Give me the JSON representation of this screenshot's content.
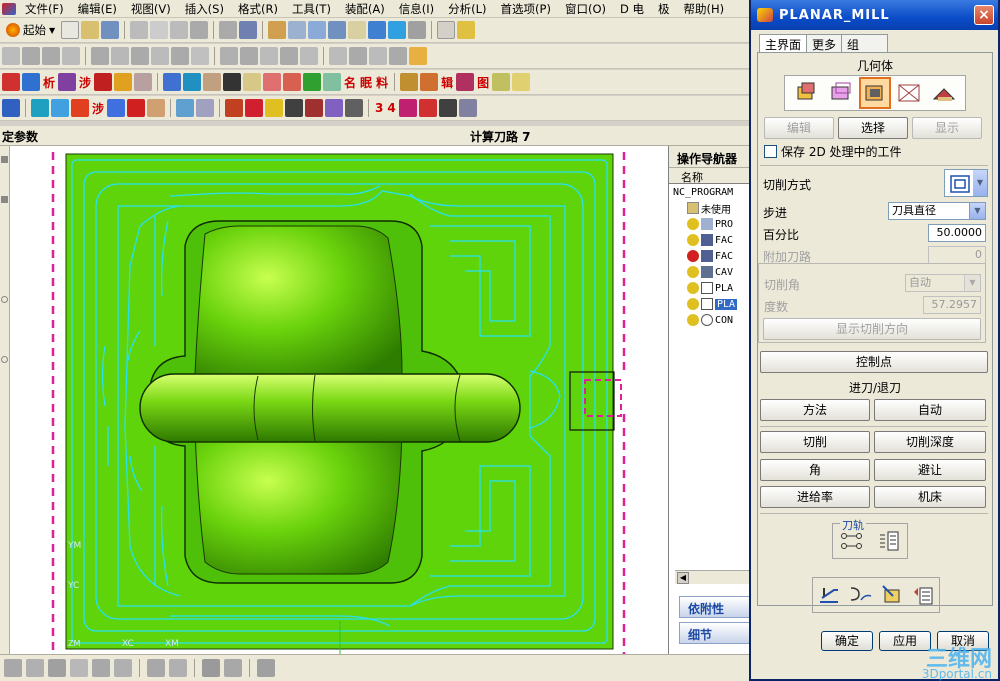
{
  "menubar": {
    "items": [
      "文件(F)",
      "编辑(E)",
      "视图(V)",
      "插入(S)",
      "格式(R)",
      "工具(T)",
      "装配(A)",
      "信息(I)",
      "分析(L)",
      "首选项(P)",
      "窗口(O)",
      "D 电",
      "极",
      "帮助(H)"
    ]
  },
  "toolbar": {
    "start_label": "起始",
    "inline_labels": [
      "析",
      "涉",
      "名",
      "眠",
      "料",
      "辑",
      "图",
      "涉",
      "3",
      "4"
    ]
  },
  "header": {
    "left_title": "定参数",
    "center_title": "计算刀路 7"
  },
  "canvas": {
    "axis_labels": [
      "YM",
      "YC",
      "XC",
      "XM",
      "ZM"
    ]
  },
  "navigator": {
    "title": "操作导航器",
    "column_header": "名称",
    "root": "NC_PROGRAM",
    "items": [
      {
        "label": "未使用",
        "status": "none"
      },
      {
        "label": "PRO",
        "status": "ok"
      },
      {
        "label": "FAC",
        "status": "ok"
      },
      {
        "label": "FAC",
        "status": "error"
      },
      {
        "label": "CAV",
        "status": "ok"
      },
      {
        "label": "PLA",
        "status": "ok"
      },
      {
        "label": "PLA",
        "status": "ok",
        "selected": true
      },
      {
        "label": "CON",
        "status": "ok"
      }
    ],
    "section_dependencies": "依附性",
    "section_details": "细节"
  },
  "dialog": {
    "title": "PLANAR_MILL",
    "close_label": "×",
    "tabs": [
      "主界面",
      "更多",
      "组"
    ],
    "active_tab": "主界面",
    "geometry_label": "几何体",
    "geometry_icons": [
      "part-geometry-icon",
      "blank-geometry-icon",
      "check-geometry-icon",
      "trim-geometry-icon",
      "floor-geometry-icon"
    ],
    "btn_edit": "编辑",
    "btn_select": "选择",
    "btn_display": "显示",
    "checkbox_label": "保存 2D 处理中的工件",
    "cut_method_label": "切削方式",
    "stepover_label": "步进",
    "stepover_value": "刀具直径",
    "percent_label": "百分比",
    "percent_value": "50.0000",
    "extra_passes_label": "附加刀路",
    "extra_passes_value": "0",
    "cut_angle_label": "切削角",
    "cut_angle_value": "自动",
    "degrees_label": "度数",
    "degrees_value": "57.2957",
    "show_direction_label": "显示切削方向",
    "control_points_label": "控制点",
    "engage_retract_label": "进刀/退刀",
    "method_label": "方法",
    "auto_label": "自动",
    "cutting_label": "切削",
    "cut_depth_label": "切削深度",
    "corner_label": "角",
    "avoidance_label": "避让",
    "feeds_label": "进给率",
    "machine_label": "机床",
    "toolpath_label": "刀轨",
    "ok_label": "确定",
    "apply_label": "应用",
    "cancel_label": "取消"
  },
  "watermark": {
    "main": "三维网",
    "sub": "3Dportal.cn"
  },
  "colors": {
    "part_green": "#5fd40a",
    "toolpath_cyan": "#28e0f0",
    "boundary_magenta": "#e0209a",
    "title_blue": "#0a4cc8"
  }
}
